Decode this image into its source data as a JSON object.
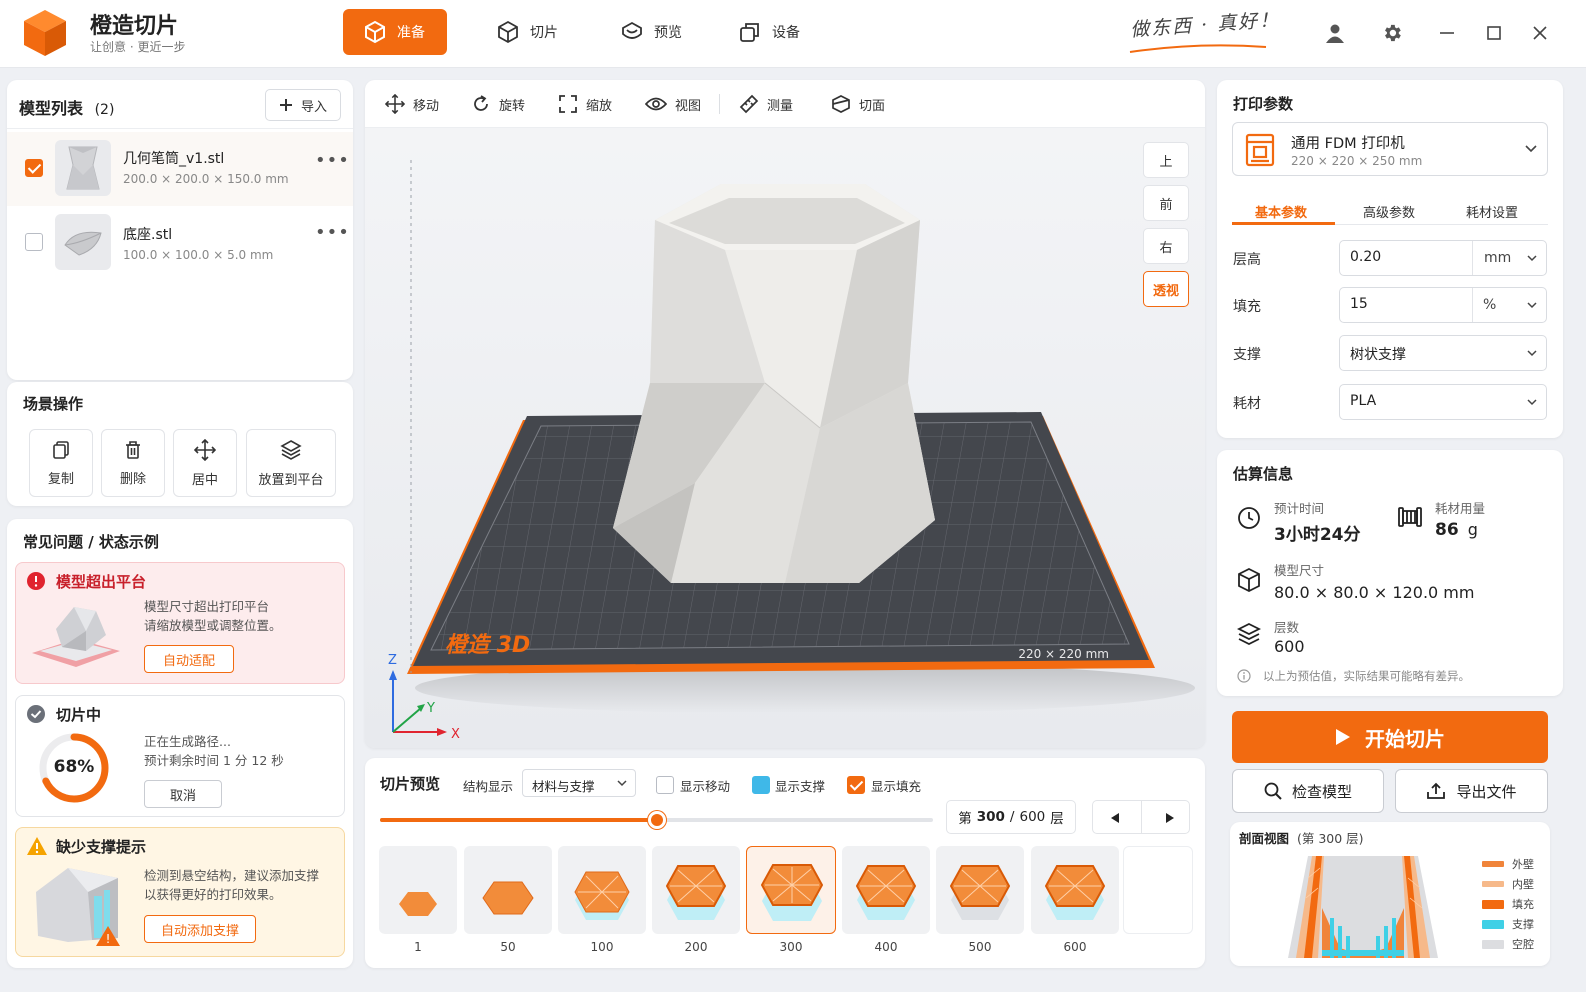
{
  "app": {
    "name": "橙造切片",
    "tagline": "让创意 · 更近一步",
    "slogan": "做东西 · 真好！"
  },
  "nav": {
    "tabs": [
      {
        "label": "准备",
        "icon": "cube-icon",
        "active": true
      },
      {
        "label": "切片",
        "icon": "slice-cube-icon",
        "active": false
      },
      {
        "label": "预览",
        "icon": "preview-icon",
        "active": false
      },
      {
        "label": "设备",
        "icon": "devices-icon",
        "active": false
      }
    ]
  },
  "model_list": {
    "title": "模型列表",
    "count": "(2)",
    "import_label": "导入",
    "items": [
      {
        "name": "几何笔筒_v1.stl",
        "size": "200.0 × 200.0 × 150.0 mm",
        "checked": true
      },
      {
        "name": "底座.stl",
        "size": "100.0 × 100.0 × 5.0 mm",
        "checked": false
      }
    ]
  },
  "scene_ops": {
    "title": "场景操作",
    "buttons": [
      {
        "label": "复制",
        "icon": "copy-icon"
      },
      {
        "label": "删除",
        "icon": "trash-icon"
      },
      {
        "label": "居中",
        "icon": "center-move-icon"
      },
      {
        "label": "放置到平台",
        "icon": "layers-icon"
      }
    ]
  },
  "faq": {
    "title": "常见问题 / 状态示例",
    "out_of_bounds": {
      "title": "模型超出平台",
      "text1": "模型尺寸超出打印平台",
      "text2": "请缩放模型或调整位置。",
      "button": "自动适配"
    },
    "slicing": {
      "title": "切片中",
      "progress_label": "68%",
      "progress": 0.68,
      "text1": "正在生成路径...",
      "text2": "预计剩余时间 1 分 12 秒",
      "button": "取消"
    },
    "support": {
      "title": "缺少支撑提示",
      "text1": "检测到悬空结构，建议添加支撑",
      "text2": "以获得更好的打印效果。",
      "button": "自动添加支撑"
    }
  },
  "toolbar": {
    "tools": [
      {
        "label": "移动",
        "icon": "move-icon"
      },
      {
        "label": "旋转",
        "icon": "rotate-icon"
      },
      {
        "label": "缩放",
        "icon": "scale-icon"
      },
      {
        "label": "视图",
        "icon": "eye-icon"
      },
      {
        "label": "测量",
        "icon": "measure-icon"
      },
      {
        "label": "切面",
        "icon": "section-icon"
      }
    ]
  },
  "viewport": {
    "views": [
      {
        "label": "上",
        "active": false
      },
      {
        "label": "前",
        "active": false
      },
      {
        "label": "右",
        "active": false
      },
      {
        "label": "透视",
        "active": true
      }
    ],
    "bed_brand": "橙造 3D",
    "bed_size": "220 × 220 mm",
    "axis_x": "X",
    "axis_y": "Y",
    "axis_z": "Z"
  },
  "slice_preview": {
    "title": "切片预览",
    "structure_label": "结构显示",
    "structure_value": "材料与支撑",
    "checkboxes": [
      {
        "label": "显示移动",
        "checked": false
      },
      {
        "label": "显示支撑",
        "checked": true
      },
      {
        "label": "显示填充",
        "checked": true
      }
    ],
    "layer_prefix": "第",
    "current_layer": "300",
    "layer_sep": "/",
    "total_layers": "600",
    "layer_suffix": "层",
    "slider_fraction": 0.5,
    "layers": [
      "1",
      "50",
      "100",
      "200",
      "300",
      "400",
      "500",
      "600"
    ],
    "active_layer": "300"
  },
  "print_params": {
    "title": "打印参数",
    "printer_name": "通用 FDM 打印机",
    "printer_size": "220 × 220 × 250 mm",
    "tabs": [
      "基本参数",
      "高级参数",
      "耗材设置"
    ],
    "fields": [
      {
        "label": "层高",
        "value": "0.20",
        "unit": "mm"
      },
      {
        "label": "填充",
        "value": "15",
        "unit": "%"
      },
      {
        "label": "支撑",
        "value": "树状支撑",
        "unit": ""
      },
      {
        "label": "耗材",
        "value": "PLA",
        "unit": ""
      }
    ]
  },
  "estimates": {
    "title": "估算信息",
    "time_label": "预计时间",
    "time_value": "3小时24分",
    "material_label": "耗材用量",
    "material_value": "86",
    "material_unit": "g",
    "size_label": "模型尺寸",
    "size_value": "80.0 × 80.0 × 120.0 mm",
    "layers_label": "层数",
    "layers_value": "600",
    "note": "以上为预估值，实际结果可能略有差异。"
  },
  "actions": {
    "start_label": "开始切片",
    "check_label": "检查模型",
    "export_label": "导出文件"
  },
  "section_view": {
    "title": "剖面视图",
    "layer_note": "(第 300 层)",
    "legend": [
      {
        "label": "外壁",
        "color": "#f0843a"
      },
      {
        "label": "内壁",
        "color": "#f6b98a"
      },
      {
        "label": "填充",
        "color": "#f26a10"
      },
      {
        "label": "支撑",
        "color": "#3fd0e6"
      },
      {
        "label": "空腔",
        "color": "#dcdde0"
      }
    ]
  },
  "colors": {
    "accent": "#f26a10",
    "support": "#3fd0e6",
    "error_bg": "#fdeced",
    "warning_bg": "#fff6e4"
  }
}
